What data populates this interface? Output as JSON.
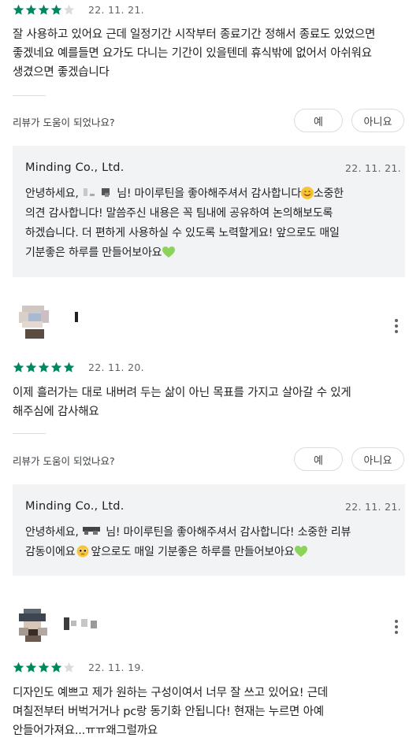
{
  "review1": {
    "rating": 4,
    "date": "22. 11. 21.",
    "text_lines": [
      "잘 사용하고 있어요 근데 일정기간 시작부터 종료기간 정해서 종료도 있었으면",
      "좋겠네요 예를들면 요가도 다니는 기간이 있을텐데 휴식밖에 없어서 아쉬워요",
      "생겼으면 좋겠습니다"
    ],
    "helpful_question": "리뷰가 도움이 되었나요?",
    "yes_label": "예",
    "no_label": "아니요",
    "reply": {
      "developer": "Minding Co., Ltd.",
      "date": "22. 11. 21.",
      "line1_a": "안녕하세요,",
      "line1_b": "님! 마이루틴을 좋아해주셔서 감사합니다",
      "line1_c": "소중한",
      "line2": "의견 감사합니다! 말씀주신 내용은 꼭 팀내에 공유하여 논의해보도록",
      "line3": "하겠습니다. 더 편하게 사용하실 수 있도록 노력할게요! 앞으로도 매일",
      "line4": "기분좋은 하루를 만들어보아요"
    }
  },
  "review2": {
    "rating": 5,
    "date": "22. 11. 20.",
    "text_lines": [
      "이제 흘러가는 대로 내버려 두는 삶이 아닌 목표를 가지고 살아갈 수 있게",
      "해주심에 감사해요"
    ],
    "helpful_question": "리뷰가 도움이 되었나요?",
    "yes_label": "예",
    "no_label": "아니요",
    "reply": {
      "developer": "Minding Co., Ltd.",
      "date": "22. 11. 21.",
      "line1_a": "안녕하세요,",
      "line1_b": "님! 마이루틴을 좋아해주셔서 감사합니다! 소중한 리뷰",
      "line2_a": "감동이에요",
      "line2_b": "앞으로도 매일 기분좋은 하루를 만들어보아요"
    }
  },
  "review3": {
    "rating": 4,
    "date": "22. 11. 19.",
    "text_lines": [
      "디자인도 예쁘고 제가 원하는 구성이여서 너무 잘 쓰고 있어요! 근데",
      "며칠전부터 버벅거거나 pc랑 동기화 안됩니다! 현재는 누르면 아예",
      "안들어가져요...ㅠㅠ왜그럴까요"
    ]
  },
  "colors": {
    "star_filled": "#01875f",
    "star_empty": "#dadce0",
    "reply_bg": "#f1f3f4",
    "heart": "#8bd35a"
  }
}
